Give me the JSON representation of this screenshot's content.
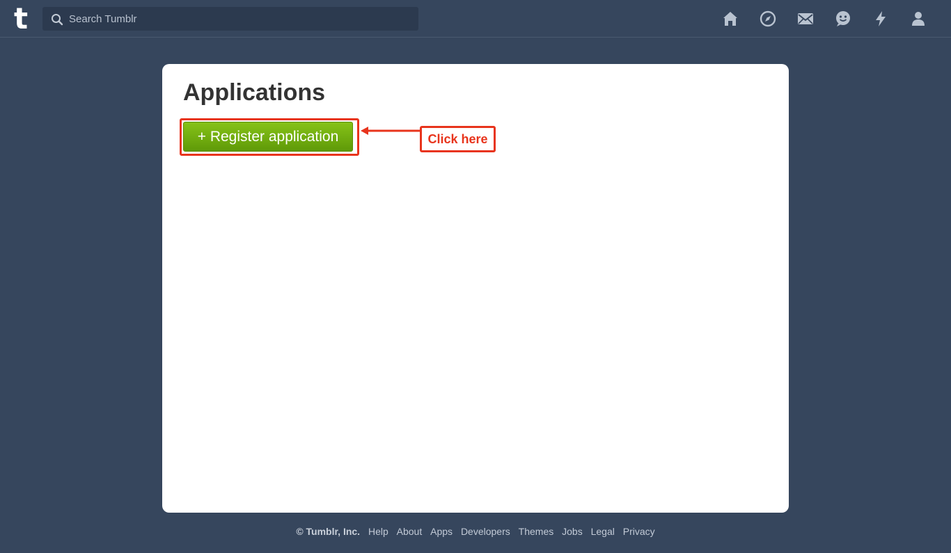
{
  "header": {
    "logo": "t",
    "search": {
      "placeholder": "Search Tumblr",
      "value": ""
    },
    "nav_icons": [
      "home-icon",
      "explore-icon",
      "inbox-icon",
      "messaging-icon",
      "activity-icon",
      "account-icon"
    ]
  },
  "main": {
    "title": "Applications",
    "register_button": "+ Register application",
    "annotation": {
      "text": "Click here",
      "color": "#e8341c"
    }
  },
  "footer": {
    "copyright": "© Tumblr, Inc.",
    "links": [
      "Help",
      "About",
      "Apps",
      "Developers",
      "Themes",
      "Jobs",
      "Legal",
      "Privacy"
    ]
  },
  "colors": {
    "background": "#36465d",
    "button": "#7ab317",
    "annotation": "#e8341c"
  }
}
